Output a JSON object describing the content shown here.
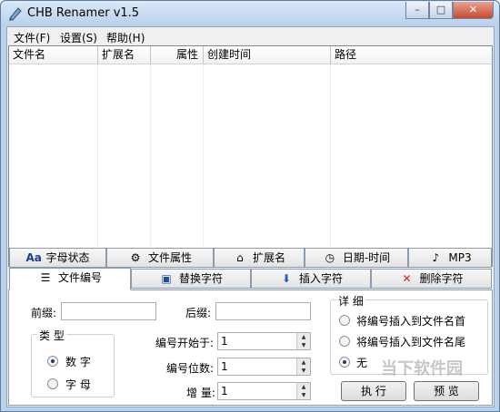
{
  "window": {
    "title": "CHB Renamer v1.5"
  },
  "menu": [
    "文件(F)",
    "设置(S)",
    "帮助(H)"
  ],
  "list": {
    "columns": [
      "文件名",
      "扩展名",
      "属性",
      "创建时间",
      "路径"
    ]
  },
  "tabs_top": [
    {
      "icon": "Aa",
      "label": "字母状态"
    },
    {
      "icon": "⚙",
      "label": "文件属性"
    },
    {
      "icon": "⌂",
      "label": "扩展名"
    },
    {
      "icon": "◷",
      "label": "日期-时间"
    },
    {
      "icon": "♪",
      "label": "MP3"
    }
  ],
  "tabs_bottom": [
    {
      "icon": "☰",
      "label": "文件编号"
    },
    {
      "icon": "▣",
      "label": "替换字符"
    },
    {
      "icon": "⬇",
      "label": "插入字符"
    },
    {
      "icon": "✕",
      "label": "删除字符"
    }
  ],
  "form": {
    "prefix_label": "前缀:",
    "prefix_value": "",
    "suffix_label": "后缀:",
    "suffix_value": "",
    "type_group_title": "类 型",
    "type_options": [
      "数 字",
      "字 母"
    ],
    "start_label": "编号开始于:",
    "start_value": "1",
    "digits_label": "编号位数:",
    "digits_value": "1",
    "increment_label": "增 量:",
    "increment_value": "1",
    "detail_group_title": "详 细",
    "detail_options": [
      "将编号插入到文件名首",
      "将编号插入到文件名尾",
      "无"
    ],
    "execute_button": "执 行",
    "preview_button": "预 览"
  },
  "watermark": "当下软件园"
}
